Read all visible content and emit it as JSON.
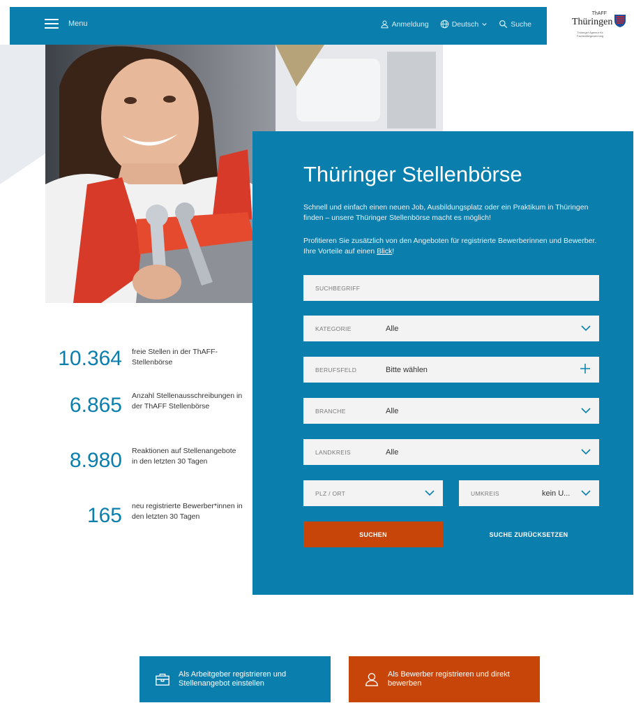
{
  "header": {
    "menu_label": "Menu",
    "login_label": "Anmeldung",
    "language_label": "Deutsch",
    "search_label": "Suche",
    "icons": [
      "hamburger-icon",
      "user-icon",
      "globe-icon",
      "chevron-down-icon",
      "search-icon"
    ]
  },
  "logo": {
    "small": "ThAFF",
    "main": "Thüringen",
    "sub": "Thüringer Agentur für Fachkräftegewinnung"
  },
  "search_panel": {
    "title": "Thüringer Stellenbörse",
    "intro": "Schnell und einfach einen neuen Job, Ausbildungsplatz oder ein Praktikum in Thüringen finden – unsere Thüringer Stellenbörse macht es möglich!",
    "intro2_prefix": "Profitieren Sie zusätzlich von den Angeboten für registrierte Bewerberinnen und Bewerber. Ihre Vorteile auf einen ",
    "intro2_link": "Blick",
    "intro2_suffix": "!",
    "keyword_placeholder": "SUCHBEGRIFF",
    "category_label": "KATEGORIE",
    "category_value": "Alle",
    "field_label": "BERUFSFELD",
    "field_value": "Bitte wählen",
    "industry_label": "BRANCHE",
    "industry_value": "Alle",
    "district_label": "LANDKREIS",
    "district_value": "Alle",
    "zip_label": "PLZ / ORT",
    "radius_label": "UMKREIS",
    "radius_value": "kein U...",
    "search_button": "SUCHEN",
    "reset_button": "SUCHE ZURÜCKSETZEN"
  },
  "stats": [
    {
      "number": "10.364",
      "text": "freie Stellen in der ThAFF-Stellenbörse"
    },
    {
      "number": "6.865",
      "text": "Anzahl Stellenausschreibungen in der ThAFF Stellenbörse"
    },
    {
      "number": "8.980",
      "text": "Reaktionen auf Stellenangebote in den letzten 30 Tagen"
    },
    {
      "number": "165",
      "text": "neu registrierte Bewerber*innen in den letzten 30 Tagen"
    }
  ],
  "cta": {
    "employer": "Als Arbeitgeber registrieren und Stellenangebot einstellen",
    "applicant": "Als Bewerber registrieren und direkt bewerben"
  },
  "colors": {
    "primary_blue": "#0a7fae",
    "accent_orange": "#c8450a",
    "field_bg": "#f3f3f3"
  }
}
